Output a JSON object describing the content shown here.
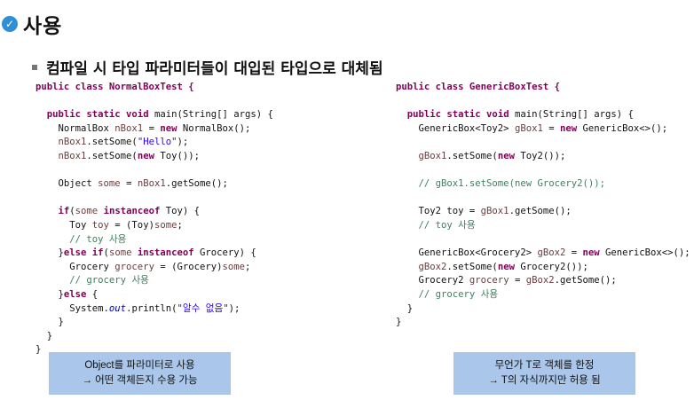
{
  "header": {
    "title": "사용",
    "subtitle": "컴파일 시 타입 파라미터들이 대입된 타입으로 대체됨"
  },
  "code_left": [
    [
      {
        "t": "public class NormalBoxTest {",
        "c": "kw"
      }
    ],
    [],
    [
      {
        "t": "  "
      },
      {
        "t": "public static void",
        "c": "kw"
      },
      {
        "t": " main(String[] args) {"
      }
    ],
    [
      {
        "t": "    NormalBox "
      },
      {
        "t": "nBox1",
        "c": "var"
      },
      {
        "t": " = "
      },
      {
        "t": "new",
        "c": "kw"
      },
      {
        "t": " NormalBox();"
      }
    ],
    [
      {
        "t": "    "
      },
      {
        "t": "nBox1",
        "c": "var"
      },
      {
        "t": ".setSome("
      },
      {
        "t": "\"Hello\"",
        "c": "str"
      },
      {
        "t": ");"
      }
    ],
    [
      {
        "t": "    "
      },
      {
        "t": "nBox1",
        "c": "var"
      },
      {
        "t": ".setSome("
      },
      {
        "t": "new",
        "c": "kw"
      },
      {
        "t": " Toy());"
      }
    ],
    [],
    [
      {
        "t": "    Object "
      },
      {
        "t": "some",
        "c": "var"
      },
      {
        "t": " = "
      },
      {
        "t": "nBox1",
        "c": "var"
      },
      {
        "t": ".getSome();"
      }
    ],
    [],
    [
      {
        "t": "    "
      },
      {
        "t": "if",
        "c": "kw"
      },
      {
        "t": "("
      },
      {
        "t": "some",
        "c": "var"
      },
      {
        "t": " "
      },
      {
        "t": "instanceof",
        "c": "kw"
      },
      {
        "t": " Toy) {"
      }
    ],
    [
      {
        "t": "      Toy "
      },
      {
        "t": "toy",
        "c": "var"
      },
      {
        "t": " = (Toy)"
      },
      {
        "t": "some",
        "c": "var"
      },
      {
        "t": ";"
      }
    ],
    [
      {
        "t": "      "
      },
      {
        "t": "// toy 사용",
        "c": "cm"
      }
    ],
    [
      {
        "t": "    }"
      },
      {
        "t": "else if",
        "c": "kw"
      },
      {
        "t": "("
      },
      {
        "t": "some",
        "c": "var"
      },
      {
        "t": " "
      },
      {
        "t": "instanceof",
        "c": "kw"
      },
      {
        "t": " Grocery) {"
      }
    ],
    [
      {
        "t": "      Grocery "
      },
      {
        "t": "grocery",
        "c": "var"
      },
      {
        "t": " = (Grocery)"
      },
      {
        "t": "some",
        "c": "var"
      },
      {
        "t": ";"
      }
    ],
    [
      {
        "t": "      "
      },
      {
        "t": "// grocery 사용",
        "c": "cm"
      }
    ],
    [
      {
        "t": "    }"
      },
      {
        "t": "else",
        "c": "kw"
      },
      {
        "t": " {"
      }
    ],
    [
      {
        "t": "      System."
      },
      {
        "t": "out",
        "c": "fld"
      },
      {
        "t": ".println("
      },
      {
        "t": "\"알수 없음\"",
        "c": "str"
      },
      {
        "t": ");"
      }
    ],
    [
      {
        "t": "    }"
      }
    ],
    [
      {
        "t": "  }"
      }
    ],
    [
      {
        "t": "}"
      }
    ]
  ],
  "code_right": [
    [
      {
        "t": "public class GenericBoxTest {",
        "c": "kw"
      }
    ],
    [],
    [
      {
        "t": "  "
      },
      {
        "t": "public static void",
        "c": "kw"
      },
      {
        "t": " main(String[] args) {"
      }
    ],
    [
      {
        "t": "    GenericBox<Toy2> "
      },
      {
        "t": "gBox1",
        "c": "var"
      },
      {
        "t": " = "
      },
      {
        "t": "new",
        "c": "kw"
      },
      {
        "t": " GenericBox<>();"
      }
    ],
    [],
    [
      {
        "t": "    "
      },
      {
        "t": "gBox1",
        "c": "var"
      },
      {
        "t": ".setSome("
      },
      {
        "t": "new",
        "c": "kw"
      },
      {
        "t": " Toy2());"
      }
    ],
    [],
    [
      {
        "t": "    "
      },
      {
        "t": "// gBox1.setSome(new Grocery2());",
        "c": "cm"
      }
    ],
    [],
    [
      {
        "t": "    Toy2 toy = "
      },
      {
        "t": "gBox1",
        "c": "var"
      },
      {
        "t": ".getSome();"
      }
    ],
    [
      {
        "t": "    "
      },
      {
        "t": "// toy 사용",
        "c": "cm"
      }
    ],
    [],
    [
      {
        "t": "    GenericBox<Grocery2> "
      },
      {
        "t": "gBox2",
        "c": "var"
      },
      {
        "t": " = "
      },
      {
        "t": "new",
        "c": "kw"
      },
      {
        "t": " GenericBox<>();"
      }
    ],
    [
      {
        "t": "    "
      },
      {
        "t": "gBox2",
        "c": "var"
      },
      {
        "t": ".setSome("
      },
      {
        "t": "new",
        "c": "kw"
      },
      {
        "t": " Grocery2());"
      }
    ],
    [
      {
        "t": "    Grocery2 "
      },
      {
        "t": "grocery",
        "c": "var"
      },
      {
        "t": " = "
      },
      {
        "t": "gBox2",
        "c": "var"
      },
      {
        "t": ".getSome();"
      }
    ],
    [
      {
        "t": "    "
      },
      {
        "t": "// grocery 사용",
        "c": "cm"
      }
    ],
    [
      {
        "t": "  }"
      }
    ],
    [
      {
        "t": "}"
      }
    ]
  ],
  "note_left": {
    "line1": "Object를 파라미터로 사용",
    "line2": "→ 어떤 객체든지 수용 가능"
  },
  "note_right": {
    "line1": "무언가 T로 객체를 한정",
    "line2": "→ T의 자식까지만 허용 됨"
  }
}
